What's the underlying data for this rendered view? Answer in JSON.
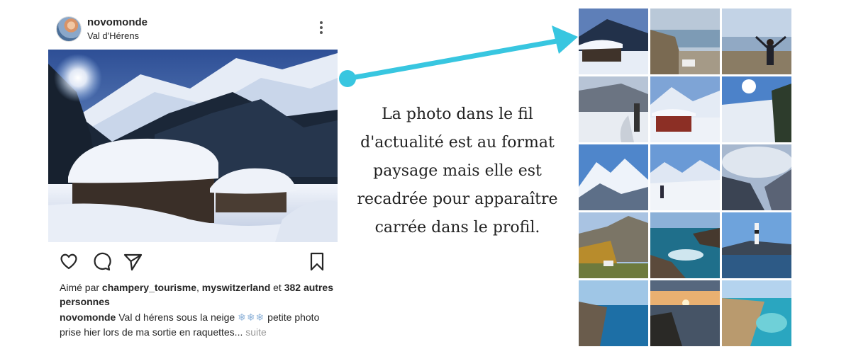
{
  "post": {
    "username": "novomonde",
    "location": "Val d'Hérens",
    "likes": {
      "prefix": "Aimé par ",
      "user1": "champery_tourisme",
      "separator": ", ",
      "user2": "myswitzerland",
      "and": " et ",
      "count": "382",
      "others": "autres personnes"
    },
    "caption": {
      "username": "novomonde",
      "text_before": " Val d hérens sous la neige ",
      "snowflakes": "❄❄❄",
      "text_after": " petite photo prise hier lors de ma sortie en raquettes...",
      "more": " suite"
    }
  },
  "annotation": {
    "text": "La photo dans le fil d'actualité est au format paysage mais elle est recadrée pour apparaître carrée dans le profil."
  },
  "icons": [
    "more-options-icon",
    "heart-icon",
    "comment-icon",
    "share-icon",
    "bookmark-icon"
  ],
  "colors": {
    "arrow": "#38c6e0",
    "link_muted": "#999999",
    "text": "#262626"
  },
  "grid": {
    "tiles": [
      "snowy-chalets-mountains",
      "lake-view-vineyard",
      "person-arms-raised-lake",
      "snowy-path-bench",
      "red-chalet-snow",
      "sunny-snow-slope",
      "snowy-peaks-blue-sky",
      "hiker-snow-ridge",
      "snow-valley-clouds",
      "autumn-valley-village",
      "rocky-coast-waves",
      "lighthouse-cliff-sea",
      "sea-cliffs-blue-water",
      "sunset-over-sea-rocks",
      "turquoise-cove"
    ]
  }
}
